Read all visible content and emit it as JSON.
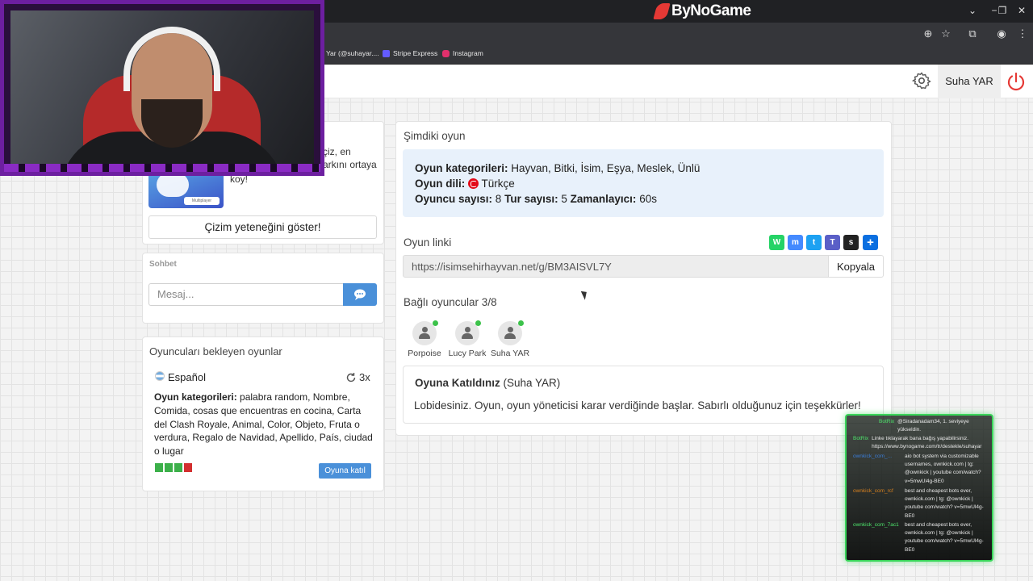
{
  "browser": {
    "brand": "ByNoGame",
    "bookmarks": [
      {
        "label": "Yar (@suhayar....",
        "color": "#777777"
      },
      {
        "label": "Stripe Express",
        "color": "#635bff"
      },
      {
        "label": "Instagram",
        "color": "#e1306c"
      }
    ]
  },
  "header": {
    "username": "Suha YAR",
    "accent": "#e53935"
  },
  "promo": {
    "text_line1": "çiz, en",
    "text_line2": "arkını ortaya",
    "text_line3": "koy!",
    "image_caption": "Multiplayer",
    "button_label": "Çizim yeteneğini göster!"
  },
  "chat": {
    "title": "Sohbet",
    "placeholder": "Mesaj..."
  },
  "waiting_games": {
    "title": "Oyuncuları bekleyen oyunlar",
    "language": "Español",
    "rounds": "3x",
    "categories_label": "Oyun kategorileri:",
    "categories_value": " palabra random, Nombre, Comida, cosas que encuentras en cocina, Carta del Clash Royale, Animal, Color, Objeto, Fruta o verdura, Regalo de Navidad, Apellido, País, ciudad o lugar",
    "player_colors": [
      "#3cb04a",
      "#3cb04a",
      "#3cb04a",
      "#d32f2f"
    ],
    "join_label": "Oyuna katıl"
  },
  "current_game": {
    "title": "Şimdiki oyun",
    "categories_label": "Oyun kategorileri:",
    "categories_value": " Hayvan, Bitki, İsim, Eşya, Meslek, Ünlü",
    "language_label": "Oyun dili:",
    "language_value": " Türkçe",
    "players_label": "Oyuncu sayısı:",
    "players_value": " 8",
    "rounds_label": "Tur sayısı:",
    "rounds_value": " 5",
    "timer_label": "Zamanlayıcı:",
    "timer_value": " 60s",
    "link_title": "Oyun linki",
    "link_url": "https://isimsehirhayvan.net/g/BM3AISVL7Y",
    "copy_label": "Kopyala",
    "share_buttons": [
      {
        "icon": "whatsapp-icon",
        "color": "#25d366",
        "glyph": "W"
      },
      {
        "icon": "messenger-icon",
        "color": "#448aff",
        "glyph": "m"
      },
      {
        "icon": "twitter-icon",
        "color": "#1da1f2",
        "glyph": "t"
      },
      {
        "icon": "teams-icon",
        "color": "#5a5fc7",
        "glyph": "T"
      },
      {
        "icon": "snapchat-icon",
        "color": "#222222",
        "glyph": "s"
      },
      {
        "icon": "share-more-icon",
        "color": "#0b6fe0",
        "glyph": "+"
      }
    ],
    "connected_title": "Bağlı oyuncular 3/8",
    "players": [
      "Porpoise",
      "Lucy Park",
      "Suha YAR"
    ],
    "joined_title": "Oyuna Katıldınız",
    "joined_user": " (Suha YAR)",
    "joined_message": "Lobidesiniz. Oyun, oyun yöneticisi karar verdiğinde başlar. Sabırlı olduğunuz için teşekkürler!"
  },
  "stream_chat": [
    {
      "user": "BotRix",
      "text": "@Siradanadam34, 1. seviyeye yükseldin."
    },
    {
      "user": "BotRix",
      "text": "Linke tıklayarak bana bağış yapabilirsiniz. https://www.bynogame.com/tr/destekle/suhayar"
    },
    {
      "user": "ownkick_com_...",
      "text": "aio bot system via customizable usernames, ownkick.com | tg: @ownkick | youtube com/watch?v=5mwUl4g-BE0"
    },
    {
      "user": "ownkick_com_rcf",
      "text": "best and cheapest bots ever, ownkick.com | tg: @ownkick | youtube com/watch? v=5mwUl4g-BE0"
    },
    {
      "user": "ownkick_com_7ac1",
      "text": "best and cheapest bots ever, ownkick.com | tg: @ownkick | youtube com/watch? v=5mwUl4g-BE0"
    }
  ]
}
